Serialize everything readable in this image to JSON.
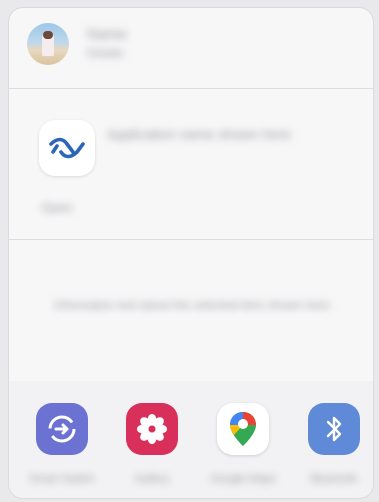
{
  "contact": {
    "name": "Name",
    "detail": "Details"
  },
  "app": {
    "title": "Application name shown here",
    "subtitle": "Open"
  },
  "info": {
    "text": "Information text about the selected item shown here"
  },
  "share_targets": [
    {
      "label": "Smart Switch",
      "icon": "smart-switch-icon",
      "color": "#6b72d2"
    },
    {
      "label": "Gallery",
      "icon": "gallery-flower-icon",
      "color": "#d8305a"
    },
    {
      "label": "Google Maps",
      "icon": "google-maps-icon",
      "color": "#ffffff"
    },
    {
      "label": "Bluetooth",
      "icon": "bluetooth-icon",
      "color": "#5f8ad8"
    }
  ]
}
